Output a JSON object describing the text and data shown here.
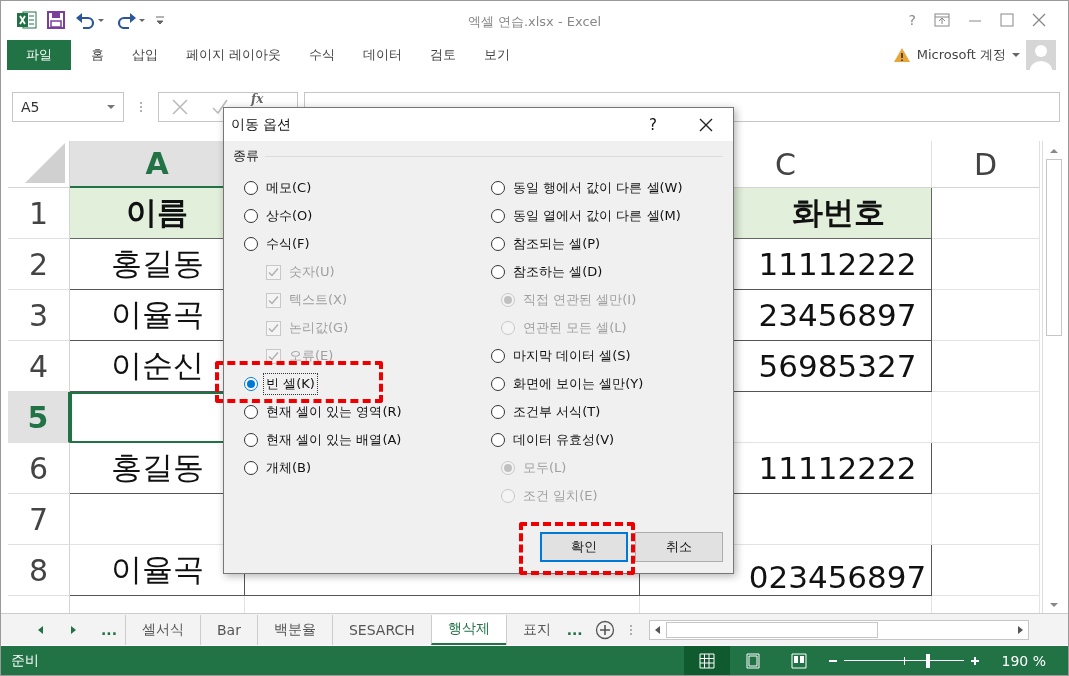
{
  "window": {
    "title": "엑셀 연습.xlsx - Excel",
    "help": "?"
  },
  "ribbon_tabs": [
    {
      "label": "파일",
      "kind": "file"
    },
    {
      "label": "홈",
      "kind": "tab"
    },
    {
      "label": "삽입",
      "kind": "tab"
    },
    {
      "label": "페이지 레이아웃",
      "kind": "tab"
    },
    {
      "label": "수식",
      "kind": "tab"
    },
    {
      "label": "데이터",
      "kind": "tab"
    },
    {
      "label": "검토",
      "kind": "tab"
    },
    {
      "label": "보기",
      "kind": "tab"
    }
  ],
  "account": {
    "label": "Microsoft 계정"
  },
  "name_box": {
    "value": "A5"
  },
  "formula_bar": {
    "function_label": "fx"
  },
  "sheet": {
    "columns": [
      {
        "label": "A",
        "selected": true
      },
      {
        "label": "C",
        "selected": false
      },
      {
        "label": "D",
        "selected": false
      }
    ],
    "rows": [
      {
        "number": "1",
        "kind": "header",
        "selected": false,
        "a": "이름",
        "c": "화번호"
      },
      {
        "number": "2",
        "kind": "data",
        "selected": false,
        "a": "홍길동",
        "c": "11112222"
      },
      {
        "number": "3",
        "kind": "data",
        "selected": false,
        "a": "이율곡",
        "c": "23456897"
      },
      {
        "number": "4",
        "kind": "data",
        "selected": false,
        "a": "이순신",
        "c": "56985327"
      },
      {
        "number": "5",
        "kind": "empty",
        "selected": true
      },
      {
        "number": "6",
        "kind": "data",
        "selected": false,
        "a": "홍길동",
        "c": "11112222"
      },
      {
        "number": "7",
        "kind": "empty",
        "selected": false
      },
      {
        "number": "8",
        "kind": "data",
        "selected": false,
        "a": "이율곡",
        "c": "023456897"
      }
    ]
  },
  "dialog": {
    "title": "이동 옵션",
    "help": "?",
    "group_label": "종류",
    "left": [
      {
        "kind": "radio",
        "label": "메모(C)",
        "selected": false
      },
      {
        "kind": "radio",
        "label": "상수(O)",
        "selected": false
      },
      {
        "kind": "radio",
        "label": "수식(F)",
        "selected": false
      },
      {
        "kind": "check",
        "label": "숫자(U)",
        "checked": true
      },
      {
        "kind": "check",
        "label": "텍스트(X)",
        "checked": true
      },
      {
        "kind": "check",
        "label": "논리값(G)",
        "checked": true
      },
      {
        "kind": "check",
        "label": "오류(E)",
        "checked": true
      },
      {
        "kind": "radio",
        "label": "빈 셀(K)",
        "selected": true
      },
      {
        "kind": "radio",
        "label": "현재 셀이 있는 영역(R)",
        "selected": false
      },
      {
        "kind": "radio",
        "label": "현재 셀이 있는 배열(A)",
        "selected": false
      },
      {
        "kind": "radio",
        "label": "개체(B)",
        "selected": false
      }
    ],
    "right": [
      {
        "kind": "radio",
        "label": "동일 행에서 값이 다른 셀(W)",
        "selected": false
      },
      {
        "kind": "radio",
        "label": "동일 열에서 값이 다른 셀(M)",
        "selected": false
      },
      {
        "kind": "radio",
        "label": "참조되는 셀(P)",
        "selected": false
      },
      {
        "kind": "radio",
        "label": "참조하는 셀(D)",
        "selected": false
      },
      {
        "kind": "subradio",
        "label": "직접 연관된 셀만(I)",
        "selected": true
      },
      {
        "kind": "subradio",
        "label": "연관된 모든 셀(L)",
        "selected": false
      },
      {
        "kind": "radio",
        "label": "마지막 데이터 셀(S)",
        "selected": false
      },
      {
        "kind": "radio",
        "label": "화면에 보이는 셀만(Y)",
        "selected": false
      },
      {
        "kind": "radio",
        "label": "조건부 서식(T)",
        "selected": false
      },
      {
        "kind": "radio",
        "label": "데이터 유효성(V)",
        "selected": false
      },
      {
        "kind": "subradio",
        "label": "모두(L)",
        "selected": true
      },
      {
        "kind": "subradio",
        "label": "조건 일치(E)",
        "selected": false
      }
    ],
    "buttons": [
      {
        "label": "확인",
        "default": true
      },
      {
        "label": "취소",
        "default": false
      }
    ]
  },
  "sheet_tabs": {
    "more_left": "...",
    "tabs": [
      {
        "label": "셀서식",
        "selected": false
      },
      {
        "label": "Bar",
        "selected": false
      },
      {
        "label": "백분율",
        "selected": false
      },
      {
        "label": "SESARCH",
        "selected": false
      },
      {
        "label": "행삭제",
        "selected": true
      },
      {
        "label": "표지",
        "selected": false
      }
    ],
    "more_right": "..."
  },
  "status_bar": {
    "text": "준비",
    "zoom_slider": {
      "level": 0.7
    },
    "zoom": "190 %"
  }
}
